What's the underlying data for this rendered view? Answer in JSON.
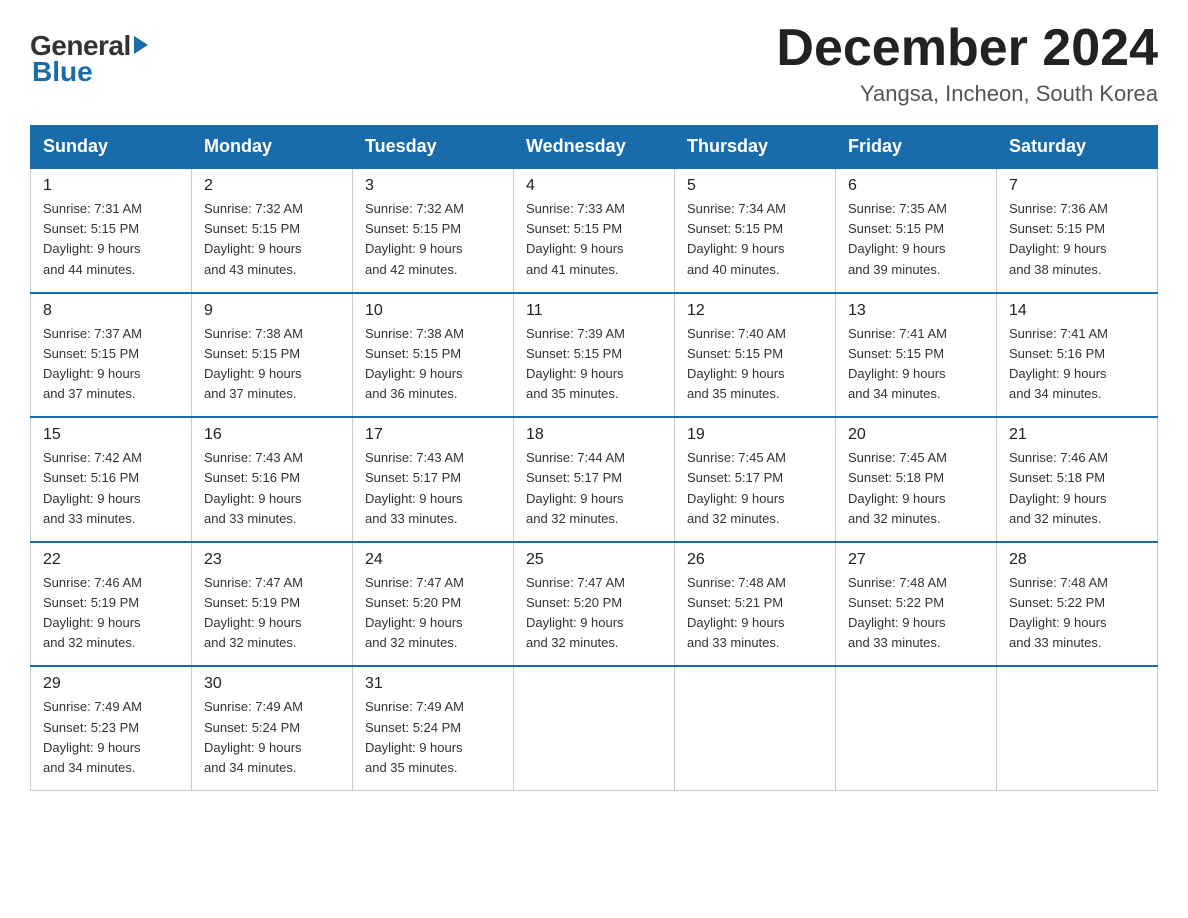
{
  "header": {
    "logo": {
      "general": "General",
      "blue": "Blue"
    },
    "title": "December 2024",
    "location": "Yangsa, Incheon, South Korea"
  },
  "days_of_week": [
    "Sunday",
    "Monday",
    "Tuesday",
    "Wednesday",
    "Thursday",
    "Friday",
    "Saturday"
  ],
  "weeks": [
    [
      {
        "day": "1",
        "sunrise": "7:31 AM",
        "sunset": "5:15 PM",
        "daylight": "9 hours and 44 minutes."
      },
      {
        "day": "2",
        "sunrise": "7:32 AM",
        "sunset": "5:15 PM",
        "daylight": "9 hours and 43 minutes."
      },
      {
        "day": "3",
        "sunrise": "7:32 AM",
        "sunset": "5:15 PM",
        "daylight": "9 hours and 42 minutes."
      },
      {
        "day": "4",
        "sunrise": "7:33 AM",
        "sunset": "5:15 PM",
        "daylight": "9 hours and 41 minutes."
      },
      {
        "day": "5",
        "sunrise": "7:34 AM",
        "sunset": "5:15 PM",
        "daylight": "9 hours and 40 minutes."
      },
      {
        "day": "6",
        "sunrise": "7:35 AM",
        "sunset": "5:15 PM",
        "daylight": "9 hours and 39 minutes."
      },
      {
        "day": "7",
        "sunrise": "7:36 AM",
        "sunset": "5:15 PM",
        "daylight": "9 hours and 38 minutes."
      }
    ],
    [
      {
        "day": "8",
        "sunrise": "7:37 AM",
        "sunset": "5:15 PM",
        "daylight": "9 hours and 37 minutes."
      },
      {
        "day": "9",
        "sunrise": "7:38 AM",
        "sunset": "5:15 PM",
        "daylight": "9 hours and 37 minutes."
      },
      {
        "day": "10",
        "sunrise": "7:38 AM",
        "sunset": "5:15 PM",
        "daylight": "9 hours and 36 minutes."
      },
      {
        "day": "11",
        "sunrise": "7:39 AM",
        "sunset": "5:15 PM",
        "daylight": "9 hours and 35 minutes."
      },
      {
        "day": "12",
        "sunrise": "7:40 AM",
        "sunset": "5:15 PM",
        "daylight": "9 hours and 35 minutes."
      },
      {
        "day": "13",
        "sunrise": "7:41 AM",
        "sunset": "5:15 PM",
        "daylight": "9 hours and 34 minutes."
      },
      {
        "day": "14",
        "sunrise": "7:41 AM",
        "sunset": "5:16 PM",
        "daylight": "9 hours and 34 minutes."
      }
    ],
    [
      {
        "day": "15",
        "sunrise": "7:42 AM",
        "sunset": "5:16 PM",
        "daylight": "9 hours and 33 minutes."
      },
      {
        "day": "16",
        "sunrise": "7:43 AM",
        "sunset": "5:16 PM",
        "daylight": "9 hours and 33 minutes."
      },
      {
        "day": "17",
        "sunrise": "7:43 AM",
        "sunset": "5:17 PM",
        "daylight": "9 hours and 33 minutes."
      },
      {
        "day": "18",
        "sunrise": "7:44 AM",
        "sunset": "5:17 PM",
        "daylight": "9 hours and 32 minutes."
      },
      {
        "day": "19",
        "sunrise": "7:45 AM",
        "sunset": "5:17 PM",
        "daylight": "9 hours and 32 minutes."
      },
      {
        "day": "20",
        "sunrise": "7:45 AM",
        "sunset": "5:18 PM",
        "daylight": "9 hours and 32 minutes."
      },
      {
        "day": "21",
        "sunrise": "7:46 AM",
        "sunset": "5:18 PM",
        "daylight": "9 hours and 32 minutes."
      }
    ],
    [
      {
        "day": "22",
        "sunrise": "7:46 AM",
        "sunset": "5:19 PM",
        "daylight": "9 hours and 32 minutes."
      },
      {
        "day": "23",
        "sunrise": "7:47 AM",
        "sunset": "5:19 PM",
        "daylight": "9 hours and 32 minutes."
      },
      {
        "day": "24",
        "sunrise": "7:47 AM",
        "sunset": "5:20 PM",
        "daylight": "9 hours and 32 minutes."
      },
      {
        "day": "25",
        "sunrise": "7:47 AM",
        "sunset": "5:20 PM",
        "daylight": "9 hours and 32 minutes."
      },
      {
        "day": "26",
        "sunrise": "7:48 AM",
        "sunset": "5:21 PM",
        "daylight": "9 hours and 33 minutes."
      },
      {
        "day": "27",
        "sunrise": "7:48 AM",
        "sunset": "5:22 PM",
        "daylight": "9 hours and 33 minutes."
      },
      {
        "day": "28",
        "sunrise": "7:48 AM",
        "sunset": "5:22 PM",
        "daylight": "9 hours and 33 minutes."
      }
    ],
    [
      {
        "day": "29",
        "sunrise": "7:49 AM",
        "sunset": "5:23 PM",
        "daylight": "9 hours and 34 minutes."
      },
      {
        "day": "30",
        "sunrise": "7:49 AM",
        "sunset": "5:24 PM",
        "daylight": "9 hours and 34 minutes."
      },
      {
        "day": "31",
        "sunrise": "7:49 AM",
        "sunset": "5:24 PM",
        "daylight": "9 hours and 35 minutes."
      },
      null,
      null,
      null,
      null
    ]
  ],
  "labels": {
    "sunrise": "Sunrise:",
    "sunset": "Sunset:",
    "daylight": "Daylight:"
  }
}
